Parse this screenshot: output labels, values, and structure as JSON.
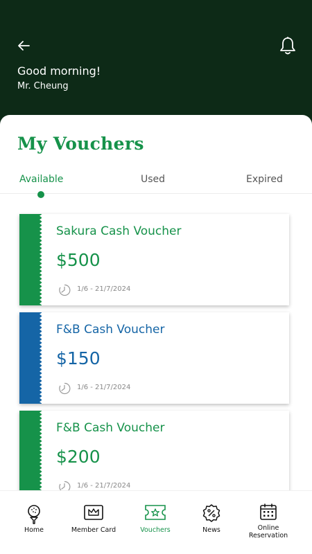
{
  "header": {
    "greeting": "Good morning!",
    "user_name": "Mr. Cheung",
    "colors": {
      "background": "#0d2a17",
      "text": "#ffffff"
    },
    "icons": {
      "back": "back-arrow-icon",
      "notifications": "bell-icon"
    }
  },
  "page": {
    "title": "My Vouchers",
    "accent": "#16924a"
  },
  "tabs": [
    {
      "label": "Available",
      "active": true
    },
    {
      "label": "Used",
      "active": false
    },
    {
      "label": "Expired",
      "active": false
    }
  ],
  "vouchers": [
    {
      "name": "Sakura Cash Voucher",
      "amount": "$500",
      "validity": "1/6 - 21/7/2024",
      "color": "#16924a"
    },
    {
      "name": "F&B Cash Voucher",
      "amount": "$150",
      "validity": "1/6 - 21/7/2024",
      "color": "#1565a6"
    },
    {
      "name": "F&B Cash Voucher",
      "amount": "$200",
      "validity": "1/6 - 21/7/2024",
      "color": "#16924a"
    }
  ],
  "bottom_nav": [
    {
      "label": "Home",
      "icon": "golf-ball-tee-icon",
      "active": false
    },
    {
      "label": "Member Card",
      "icon": "crown-card-icon",
      "active": false
    },
    {
      "label": "Vouchers",
      "icon": "star-ticket-icon",
      "active": true
    },
    {
      "label": "News",
      "icon": "percent-badge-icon",
      "active": false
    },
    {
      "label": "Online\nReservation",
      "icon": "calendar-icon",
      "active": false
    }
  ]
}
